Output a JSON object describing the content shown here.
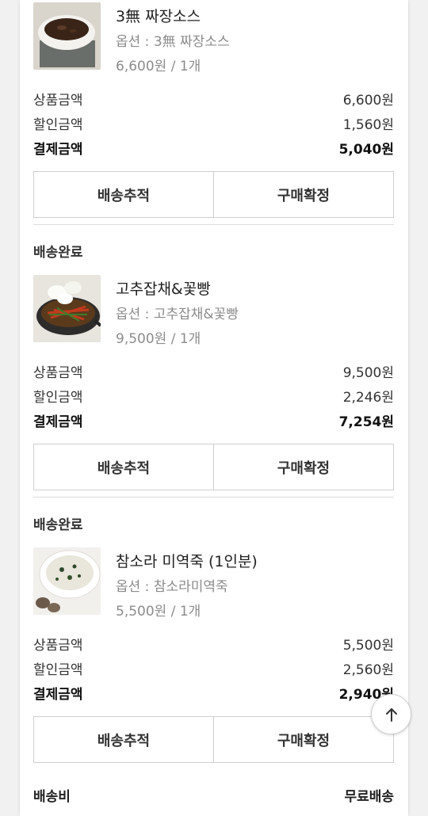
{
  "orders": [
    {
      "status": "",
      "product": {
        "name": "3無 짜장소스",
        "option": "옵션 : 3無 짜장소스",
        "price_qty": "6,600원 / 1개",
        "image": "bowl-of-jjajang-sauce"
      },
      "summary": {
        "product_amount_label": "상품금액",
        "product_amount": "6,600원",
        "discount_label": "할인금액",
        "discount": "1,560원",
        "payment_label": "결제금액",
        "payment": "5,040원"
      },
      "buttons": {
        "track": "배송추적",
        "confirm": "구매확정"
      }
    },
    {
      "status": "배송완료",
      "product": {
        "name": "고추잡채&꽃빵",
        "option": "옵션 : 고추잡채&꽃빵",
        "price_qty": "9,500원 / 1개",
        "image": "pan-of-gochujapchae-with-buns"
      },
      "summary": {
        "product_amount_label": "상품금액",
        "product_amount": "9,500원",
        "discount_label": "할인금액",
        "discount": "2,246원",
        "payment_label": "결제금액",
        "payment": "7,254원"
      },
      "buttons": {
        "track": "배송추적",
        "confirm": "구매확정"
      }
    },
    {
      "status": "배송완료",
      "product": {
        "name": "참소라 미역죽 (1인분)",
        "option": "옵션 : 참소라미역죽",
        "price_qty": "5,500원 / 1개",
        "image": "bowl-of-seaweed-porridge"
      },
      "summary": {
        "product_amount_label": "상품금액",
        "product_amount": "5,500원",
        "discount_label": "할인금액",
        "discount": "2,560원",
        "payment_label": "결제금액",
        "payment": "2,940원"
      },
      "buttons": {
        "track": "배송추적",
        "confirm": "구매확정"
      }
    }
  ],
  "shipping": {
    "label": "배송비",
    "value": "무료배송"
  },
  "scroll_top": {
    "icon": "arrow-up-icon"
  },
  "colors": {
    "border": "#cfcfcf",
    "muted_text": "#8c8c8c",
    "divider": "#dcdcdc"
  }
}
